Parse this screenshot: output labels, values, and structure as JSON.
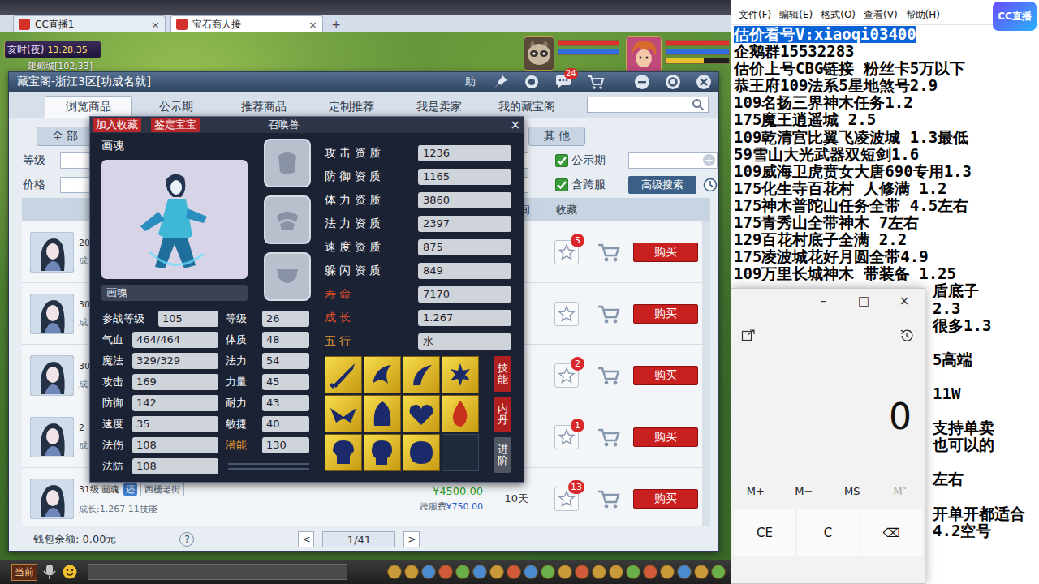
{
  "browser_tabs": [
    {
      "label": "CC直播1",
      "close": "×",
      "selected": false
    },
    {
      "label": "宝石商人接",
      "close": "×",
      "selected": true
    }
  ],
  "new_tab": "+",
  "hud": {
    "time_period": "亥时(夜)",
    "clock": "13:28:35",
    "location": "建邺城[102,33]",
    "pet_bars": [
      {
        "level": 1,
        "color": "#e0302c"
      },
      {
        "level": 1,
        "color": "#2f6ee0"
      }
    ],
    "player_bars": [
      {
        "level": 1,
        "color": "#e0302c"
      },
      {
        "level": 1,
        "color": "#2f6ee0"
      },
      {
        "level": 0.6,
        "color": "#e8c030"
      }
    ]
  },
  "shop": {
    "title": "藏宝阁-浙江3区[功成名就]",
    "help": "助",
    "message_badge": "24",
    "tabs": [
      {
        "label": "浏览商品",
        "selected": true
      },
      {
        "label": "公示期",
        "selected": false
      },
      {
        "label": "推荐商品",
        "selected": false
      },
      {
        "label": "定制推荐",
        "selected": false
      },
      {
        "label": "我是卖家",
        "selected": false
      },
      {
        "label": "我的藏宝阁",
        "selected": false
      }
    ],
    "filters": {
      "all": "全 部",
      "other": "其 他",
      "level_label": "等级",
      "price_label": "价格",
      "add": "+",
      "advanced": "高级搜索",
      "checks": [
        {
          "label": "公示期",
          "checked": true
        },
        {
          "label": "含跨服",
          "checked": true
        }
      ]
    },
    "columns": {
      "days": "间",
      "favorite": "收藏"
    },
    "buy_label": "购买",
    "rows": [
      {
        "kind": "covered",
        "line1": "20",
        "line2": "成",
        "badge": "5"
      },
      {
        "kind": "covered",
        "line1": "30",
        "line2": "成"
      },
      {
        "kind": "covered",
        "line1": "30",
        "line2": "成",
        "badge": "2"
      },
      {
        "kind": "covered",
        "line1": "2",
        "line2": "成",
        "badge": "1"
      },
      {
        "kind": "full",
        "line1": "31级 画魂",
        "tag": "还",
        "server": "西栅老街",
        "line2": "成长:1.267 11技能",
        "price": "¥4500.00",
        "fee_label": "跨服费",
        "fee": "¥750.00",
        "days": "10天",
        "badge": "13"
      }
    ],
    "wallet": "钱包余额: 0.00元",
    "help_q": "?",
    "pager": {
      "prev": "<",
      "page": "1/41",
      "next": ">"
    }
  },
  "pet": {
    "collect": "加入收藏",
    "appraise": "鉴定宝宝",
    "title": "召唤兽",
    "close": "×",
    "name_label": "画魂",
    "name_field": "画魂",
    "equip_slots": [
      {
        "filled": false
      },
      {
        "filled": false
      },
      {
        "filled": false
      }
    ],
    "battle_level": {
      "label": "参战等级",
      "value": "105"
    },
    "level": {
      "label": "等级",
      "value": "26"
    },
    "stats": [
      {
        "label": "气血",
        "value": "464/464",
        "attr": "体质",
        "attr_value": "48",
        "highlight": false
      },
      {
        "label": "魔法",
        "value": "329/329",
        "attr": "法力",
        "attr_value": "54",
        "highlight": false
      },
      {
        "label": "攻击",
        "value": "169",
        "attr": "力量",
        "attr_value": "45",
        "highlight": false
      },
      {
        "label": "防御",
        "value": "142",
        "attr": "耐力",
        "attr_value": "43",
        "highlight": false
      },
      {
        "label": "速度",
        "value": "35",
        "attr": "敏捷",
        "attr_value": "40",
        "highlight": false
      },
      {
        "label": "法伤",
        "value": "108",
        "attr": "潜能",
        "attr_value": "130",
        "highlight": true
      },
      {
        "label": "法防",
        "value": "108",
        "highlight": false
      }
    ],
    "aptitudes": [
      {
        "label": "攻 击 资 质",
        "value": "1236",
        "kind": "aptitude"
      },
      {
        "label": "防 御 资 质",
        "value": "1165",
        "kind": "aptitude"
      },
      {
        "label": "体 力 资 质",
        "value": "3860",
        "kind": "aptitude"
      },
      {
        "label": "法 力 资 质",
        "value": "2397",
        "kind": "aptitude"
      },
      {
        "label": "速 度 资 质",
        "value": "875",
        "kind": "aptitude"
      },
      {
        "label": "躲 闪 资 质",
        "value": "849",
        "kind": "aptitude"
      },
      {
        "label": "寿 命",
        "value": "7170",
        "kind": "special"
      },
      {
        "label": "成 长",
        "value": "1.267",
        "kind": "special"
      },
      {
        "label": "五 行",
        "value": "水",
        "kind": "element"
      }
    ],
    "skill_slots": [
      {
        "filled": true
      },
      {
        "filled": true
      },
      {
        "filled": true
      },
      {
        "filled": true
      },
      {
        "filled": true
      },
      {
        "filled": true
      },
      {
        "filled": true
      },
      {
        "filled": true
      },
      {
        "filled": true
      },
      {
        "filled": true
      },
      {
        "filled": true
      },
      {
        "filled": false
      }
    ],
    "side_buttons": [
      {
        "label": "技能",
        "enabled": true
      },
      {
        "label": "内丹",
        "enabled": true
      },
      {
        "label": "进阶",
        "enabled": false
      }
    ]
  },
  "bottom_bar": {
    "channel": "当前"
  },
  "notepad": {
    "menu": [
      "文件(F)",
      "编辑(E)",
      "格式(O)",
      "查看(V)",
      "帮助(H)"
    ],
    "lines": [
      {
        "text": "估价看号V:xiaoqi03400",
        "selected": true,
        "kind": "full"
      },
      {
        "text": "企鹅群15532283",
        "selected": false,
        "kind": "full"
      },
      {
        "text": "估价上号CBG链接 粉丝卡5万以下",
        "selected": false,
        "kind": "full"
      },
      {
        "text": "恭王府109法系5星地煞号2.9",
        "selected": false,
        "kind": "full"
      },
      {
        "text": "109名扬三界神木任务1.2",
        "selected": false,
        "kind": "full"
      },
      {
        "text": "175魔王逍遥城 2.5",
        "selected": false,
        "kind": "full"
      },
      {
        "text": "109乾清宫比翼飞凌波城 1.3最低",
        "selected": false,
        "kind": "full"
      },
      {
        "text": "59雪山大光武器双短剑1.6",
        "selected": false,
        "kind": "full"
      },
      {
        "text": "109威海卫虎贲女大唐690专用1.3",
        "selected": false,
        "kind": "full"
      },
      {
        "text": "175化生寺百花村 人修满 1.2",
        "selected": false,
        "kind": "full"
      },
      {
        "text": "175神木普陀山任务全带 4.5左右",
        "selected": false,
        "kind": "full"
      },
      {
        "text": "175青秀山全带神木  7左右",
        "selected": false,
        "kind": "full"
      },
      {
        "text": "129百花村底子全满 2.2",
        "selected": false,
        "kind": "full"
      },
      {
        "text": "175凌波城花好月圆全带4.9",
        "selected": false,
        "kind": "full"
      },
      {
        "text": "109万里长城神木 带装备  1.25",
        "selected": false,
        "kind": "full"
      },
      {
        "text": "盾底子",
        "selected": false,
        "kind": "fragment"
      },
      {
        "text": "2.3",
        "selected": false,
        "kind": "fragment"
      },
      {
        "text": "很多1.3",
        "selected": false,
        "kind": "fragment"
      },
      {
        "text": "",
        "selected": false,
        "kind": "fragment"
      },
      {
        "text": "5高端",
        "selected": false,
        "kind": "fragment"
      },
      {
        "text": "",
        "selected": false,
        "kind": "fragment"
      },
      {
        "text": "11W",
        "selected": false,
        "kind": "fragment"
      },
      {
        "text": "",
        "selected": false,
        "kind": "fragment"
      },
      {
        "text": "支持单卖",
        "selected": false,
        "kind": "fragment"
      },
      {
        "text": "也可以的",
        "selected": false,
        "kind": "fragment"
      },
      {
        "text": "",
        "selected": false,
        "kind": "fragment"
      },
      {
        "text": "左右",
        "selected": false,
        "kind": "fragment"
      },
      {
        "text": "",
        "selected": false,
        "kind": "fragment"
      },
      {
        "text": "开单开都适合",
        "selected": false,
        "kind": "fragment"
      },
      {
        "text": "4.2空号",
        "selected": false,
        "kind": "fragment"
      }
    ]
  },
  "calculator": {
    "controls": [
      "–",
      "□",
      "×"
    ],
    "display": "0",
    "memory": [
      {
        "label": "M+",
        "disabled": false
      },
      {
        "label": "M−",
        "disabled": false
      },
      {
        "label": "MS",
        "disabled": false
      },
      {
        "label": "M˅",
        "disabled": true
      }
    ],
    "keys": [
      "CE",
      "C",
      "⌫"
    ]
  },
  "logo": "CC直播"
}
